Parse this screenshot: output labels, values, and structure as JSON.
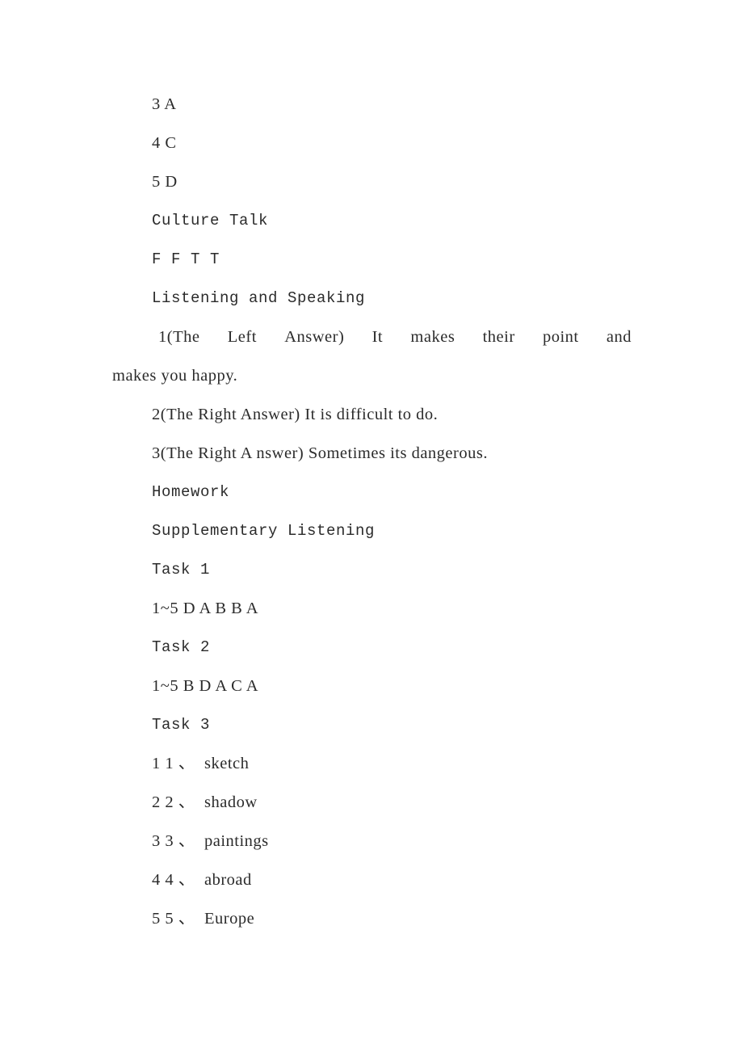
{
  "document": {
    "background_color": "#ffffff",
    "text_color": "#2b2b2b",
    "lines": {
      "ans_3": "3 A",
      "ans_4": "4 C",
      "ans_5": "5 D",
      "culture_talk_heading": "Culture Talk",
      "culture_talk_answers": "F F T T",
      "listening_speaking_heading": "Listening and Speaking",
      "ls_item1_justified": "1(The Left Answer) It makes their point and",
      "ls_item1_wrap": "makes you happy.",
      "ls_item2": "2(The Right Answer) It is difficult to do.",
      "ls_item3": "3(The Right A nswer) Sometimes its dangerous.",
      "homework_heading": "Homework",
      "supplementary_listening_heading": "Supplementary Listening",
      "task1_heading": "Task 1",
      "task1_answers": "1~5 D A B B A",
      "task2_heading": "Task 2",
      "task2_answers": "1~5 B D A C A",
      "task3_heading": "Task 3"
    },
    "justified_line_words": [
      "1(The",
      "Left",
      "Answer)",
      "It",
      "makes",
      "their",
      "point",
      "and"
    ],
    "task3_vocabulary": [
      {
        "num_a": "1",
        "num_b": "1",
        "sep": "、",
        "word": "sketch"
      },
      {
        "num_a": "2",
        "num_b": "2",
        "sep": "、",
        "word": "shadow"
      },
      {
        "num_a": "3",
        "num_b": "3",
        "sep": "、",
        "word": "paintings"
      },
      {
        "num_a": "4",
        "num_b": "4",
        "sep": "、",
        "word": "abroad"
      },
      {
        "num_a": "5",
        "num_b": "5",
        "sep": "、",
        "word": "Europe"
      }
    ]
  }
}
